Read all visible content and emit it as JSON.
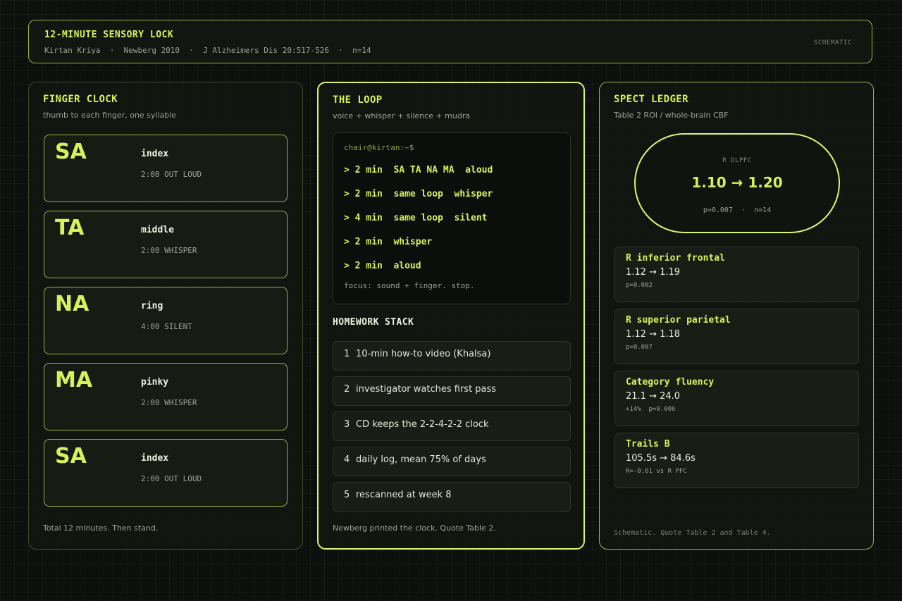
{
  "header": {
    "title": "12-MINUTE SENSORY LOCK",
    "subtitle": "Kirtan Kriya  ·  Newberg 2010  ·  J Alzheimers Dis 20:517-526  ·  n=14",
    "badge": "SCHEMATIC"
  },
  "finger_clock": {
    "title": "FINGER CLOCK",
    "subtitle": "thumb to each finger, one syllable",
    "items": [
      {
        "syllable": "SA",
        "finger": "index",
        "time": "2:00 OUT LOUD"
      },
      {
        "syllable": "TA",
        "finger": "middle",
        "time": "2:00 WHISPER"
      },
      {
        "syllable": "NA",
        "finger": "ring",
        "time": "4:00 SILENT"
      },
      {
        "syllable": "MA",
        "finger": "pinky",
        "time": "2:00 WHISPER"
      },
      {
        "syllable": "SA",
        "finger": "index",
        "time": "2:00 OUT LOUD"
      }
    ],
    "footer": "Total 12 minutes. Then stand."
  },
  "loop": {
    "title": "THE LOOP",
    "subtitle": "voice + whisper + silence + mudra",
    "terminal": {
      "prompt": "chair@kirtan:~$",
      "lines": [
        "> 2 min  SA TA NA MA  aloud",
        "> 2 min  same loop  whisper",
        "> 4 min  same loop  silent",
        "> 2 min  whisper",
        "> 2 min  aloud"
      ],
      "footer": "focus: sound + finger. stop."
    },
    "stack_title": "HOMEWORK STACK",
    "stack": [
      {
        "num": "1",
        "text": "10-min how-to video (Khalsa)"
      },
      {
        "num": "2",
        "text": "investigator watches first pass"
      },
      {
        "num": "3",
        "text": "CD keeps the 2-2-4-2-2 clock"
      },
      {
        "num": "4",
        "text": "daily log, mean 75% of days"
      },
      {
        "num": "5",
        "text": "rescanned at week 8"
      }
    ],
    "footer": "Newberg printed the clock. Quote Table 2."
  },
  "ledger": {
    "title": "SPECT LEDGER",
    "subtitle": "Table 2  ROI / whole-brain CBF",
    "hero": {
      "roi": "R DLPFC",
      "value": "1.10 → 1.20",
      "stat": "p=0.007  ·  n=14"
    },
    "rows": [
      {
        "name": "R inferior frontal",
        "value": "1.12 → 1.19",
        "stat": "p=0.002"
      },
      {
        "name": "R superior parietal",
        "value": "1.12 → 1.18",
        "stat": "p=0.007"
      },
      {
        "name": "Category fluency",
        "value": "21.1 → 24.0",
        "stat": "+14%  p=0.006"
      },
      {
        "name": "Trails B",
        "value": "105.5s → 84.6s",
        "stat": "R=-0.61 vs R PFC"
      }
    ],
    "footer": "Schematic. Quote Table 2 and Table 4."
  }
}
